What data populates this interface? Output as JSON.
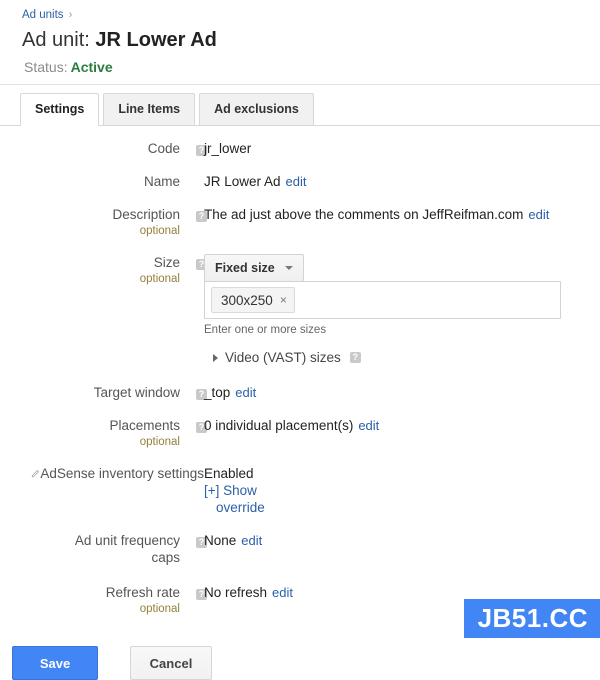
{
  "breadcrumb": {
    "link_label": "Ad units",
    "separator": "›"
  },
  "header": {
    "title_prefix": "Ad unit:",
    "title_value": "JR Lower Ad",
    "status_label": "Status:",
    "status_value": "Active"
  },
  "tabs": [
    {
      "label": "Settings",
      "active": true
    },
    {
      "label": "Line Items",
      "active": false
    },
    {
      "label": "Ad exclusions",
      "active": false
    }
  ],
  "help_glyph": "?",
  "form": {
    "code": {
      "label": "Code",
      "value": "jr_lower"
    },
    "name": {
      "label": "Name",
      "value": "JR Lower Ad",
      "edit": "edit"
    },
    "description": {
      "label": "Description",
      "optional": "optional",
      "value": "The ad just above the comments on JeffReifman.com",
      "edit": "edit"
    },
    "size": {
      "label": "Size",
      "optional": "optional",
      "dropdown_value": "Fixed size",
      "chips": [
        {
          "label": "300x250",
          "remove": "×"
        }
      ],
      "hint": "Enter one or more sizes",
      "vast_label": "Video (VAST) sizes"
    },
    "target_window": {
      "label": "Target window",
      "value": "_top",
      "edit": "edit"
    },
    "placements": {
      "label": "Placements",
      "optional": "optional",
      "value": "0 individual placement(s)",
      "edit": "edit"
    },
    "adsense": {
      "label": "AdSense inventory settings",
      "value": "Enabled",
      "show_link": "[+] Show",
      "show_link_second": "override"
    },
    "frequency_caps": {
      "label_line1": "Ad unit frequency",
      "label_line2": "caps",
      "value": "None",
      "edit": "edit"
    },
    "refresh_rate": {
      "label": "Refresh rate",
      "optional": "optional",
      "value": "No refresh",
      "edit": "edit"
    }
  },
  "buttons": {
    "save": "Save",
    "cancel": "Cancel"
  },
  "watermark": {
    "text": "JB51.CC"
  },
  "colors": {
    "accent_blue": "#4285f4",
    "link_blue": "#2b5fa8",
    "status_green": "#2a7d3f",
    "optional_olive": "#96803c"
  }
}
